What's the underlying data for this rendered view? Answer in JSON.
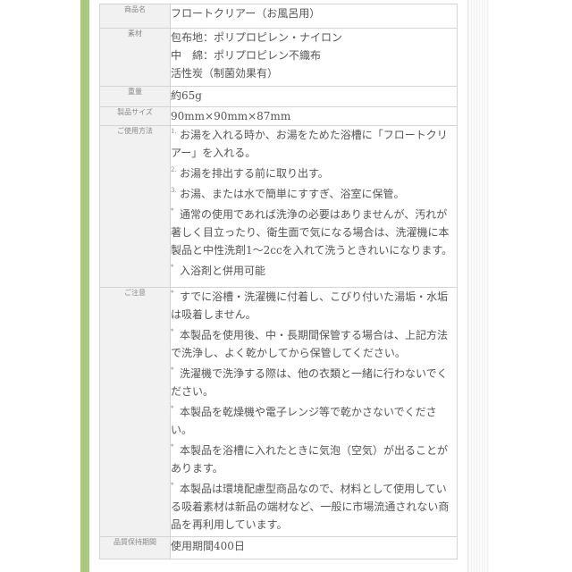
{
  "rows": [
    {
      "label": "商品名",
      "lines": [
        "フロートクリアー（お風呂用）"
      ]
    },
    {
      "label": "素材",
      "lines": [
        "包布地：ポリプロピレン・ナイロン",
        "中　綿：ポリプロピレン不織布",
        "活性炭（制菌効果有）"
      ]
    },
    {
      "label": "重量",
      "lines": [
        "約65g"
      ]
    },
    {
      "label": "製品サイズ",
      "lines": [
        "90mm×90mm×87mm"
      ]
    },
    {
      "label": "ご使用方法",
      "items": [
        {
          "mark": "1.",
          "text": "お湯を入れる時か、お湯をためた浴槽に「フロートクリアー」を入れる。"
        },
        {
          "mark": "2.",
          "text": "お湯を排出する前に取り出す。"
        },
        {
          "mark": "3.",
          "text": "お湯、または水で簡単にすすぎ、浴室に保管。"
        },
        {
          "mark": "*",
          "text": "通常の使用であれば洗浄の必要はありませんが、汚れが著しく目立ったり、衛生面で気になる場合は、洗濯機に本製品と中性洗剤1〜2ccを入れて洗うときれいになります。"
        },
        {
          "mark": "*",
          "text": "入浴剤と併用可能"
        }
      ]
    },
    {
      "label": "ご注意",
      "items": [
        {
          "mark": "*",
          "text": "すでに浴槽・洗濯機に付着し、こびり付いた湯垢・水垢は吸着しません。"
        },
        {
          "mark": "*",
          "text": "本製品を使用後、中・長期間保管する場合は、上記方法で洗浄し、よく乾かしてから保管してください。"
        },
        {
          "mark": "*",
          "text": "洗濯機で洗浄する際は、他の衣類と一緒に行わないでください。"
        },
        {
          "mark": "*",
          "text": "本製品を乾燥機や電子レンジ等で乾かさないでください。"
        },
        {
          "mark": "*",
          "text": "本製品を浴槽に入れたときに気泡（空気）が出ることがあります。"
        },
        {
          "mark": "*",
          "text": "本製品は環境配慮型商品なので、材料として使用している吸着素材は新品の端材など、一般に市場流通されない商品を再利用しています。"
        }
      ]
    },
    {
      "label": "品質保持期間",
      "lines": [
        "使用期間400日"
      ]
    }
  ]
}
